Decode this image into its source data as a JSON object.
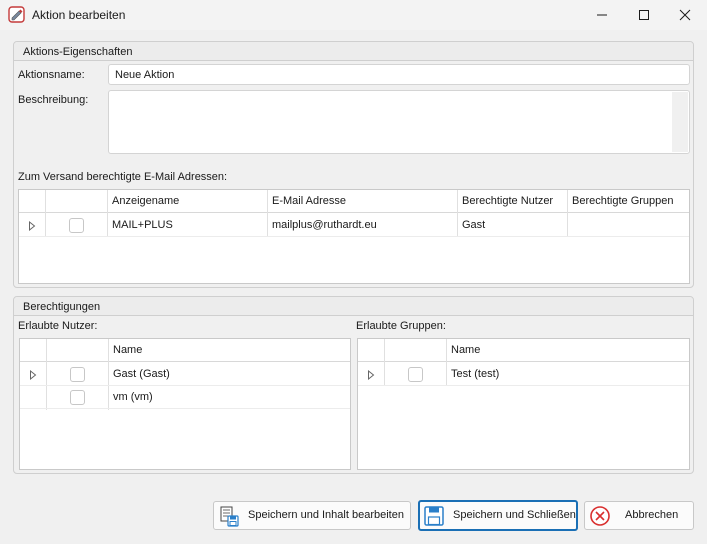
{
  "window": {
    "title": "Aktion bearbeiten"
  },
  "action_properties": {
    "group_title": "Aktions-Eigenschaften",
    "name_label": "Aktionsname:",
    "name_value": "Neue Aktion",
    "description_label": "Beschreibung:",
    "description_value": ""
  },
  "email_section": {
    "label": "Zum Versand berechtigte E-Mail Adressen:",
    "columns": [
      "Anzeigename",
      "E-Mail Adresse",
      "Berechtigte Nutzer",
      "Berechtigte Gruppen"
    ],
    "rows": [
      {
        "display_name": "MAIL+PLUS",
        "email": "mailplus@ruthardt.eu",
        "users": "Gast",
        "groups": ""
      }
    ]
  },
  "permissions": {
    "group_title": "Berechtigungen",
    "users_label": "Erlaubte Nutzer:",
    "groups_label": "Erlaubte Gruppen:",
    "users_column": "Name",
    "groups_column": "Name",
    "users": [
      "Gast (Gast)",
      "vm (vm)"
    ],
    "groups": [
      "Test (test)"
    ]
  },
  "buttons": {
    "save_edit": "Speichern und Inhalt bearbeiten",
    "save_close": "Speichern und Schließen",
    "cancel": "Abbrechen"
  },
  "colors": {
    "primary_border": "#1a6fb5",
    "cancel_icon": "#d9302f",
    "save_icon": "#2a7fc9"
  },
  "icons": {
    "app": "app-edit-icon",
    "minimize": "minimize-icon",
    "maximize": "maximize-icon",
    "close": "close-icon",
    "save_edit": "save-document-icon",
    "save_close": "save-disk-icon",
    "cancel": "cancel-circle-icon"
  }
}
